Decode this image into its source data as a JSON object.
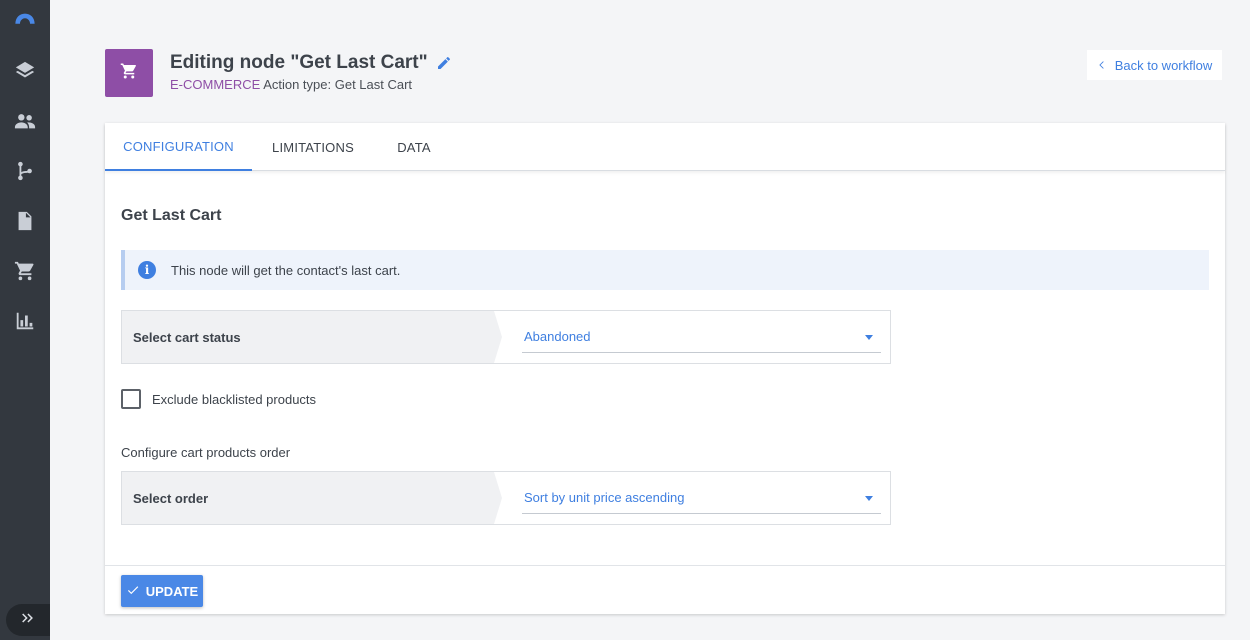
{
  "sidebar": {
    "items": [
      {
        "icon": "logo-arc-icon"
      },
      {
        "icon": "layers-icon"
      },
      {
        "icon": "users-icon"
      },
      {
        "icon": "workflow-icon"
      },
      {
        "icon": "document-icon"
      },
      {
        "icon": "cart-icon"
      },
      {
        "icon": "chart-icon"
      }
    ],
    "expand_icon": "double-chevron-right-icon"
  },
  "header": {
    "title": "Editing node \"Get Last Cart\"",
    "category": "E-COMMERCE",
    "action_type": "Action type: Get Last Cart",
    "back_label": "Back to workflow",
    "badge_color": "#8e4ea6"
  },
  "tabs": [
    {
      "label": "CONFIGURATION",
      "active": true
    },
    {
      "label": "LIMITATIONS",
      "active": false
    },
    {
      "label": "DATA",
      "active": false
    }
  ],
  "config": {
    "section_title": "Get Last Cart",
    "info_text": "This node will get the contact's last cart.",
    "cart_status": {
      "label": "Select cart status",
      "value": "Abandoned"
    },
    "exclude_blacklisted": {
      "label": "Exclude blacklisted products",
      "checked": false
    },
    "order_heading": "Configure cart products order",
    "order": {
      "label": "Select order",
      "value": "Sort by unit price ascending"
    }
  },
  "footer": {
    "update_label": "UPDATE"
  },
  "colors": {
    "accent": "#3f7fe0",
    "ecommerce": "#8e4ea6",
    "sidebar": "#33383f"
  }
}
